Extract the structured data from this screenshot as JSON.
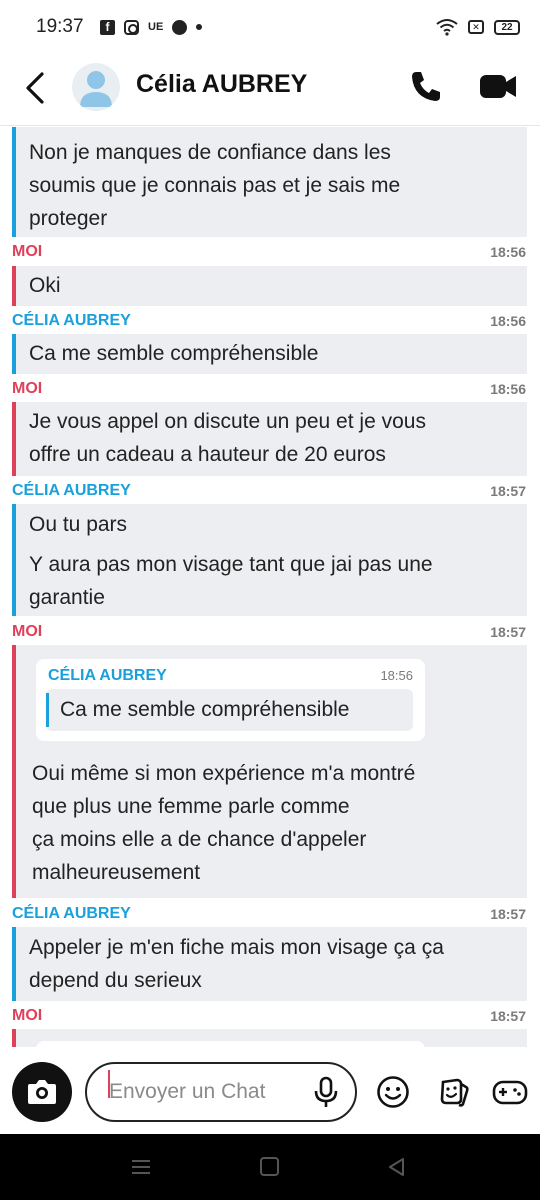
{
  "status_bar": {
    "time": "19:37",
    "app_icons": [
      "facebook-icon",
      "instagram-icon",
      "ue-icon",
      "messenger-icon",
      "dot-icon"
    ],
    "ue_label": "UE",
    "battery": "22"
  },
  "header": {
    "contact_name": "Célia AUBREY"
  },
  "colors": {
    "moi": "#e0415a",
    "celia": "#1aa0db",
    "bubble_bg": "#eceef1"
  },
  "messages": [
    {
      "lines": [
        "Non je manques de confiance dans les",
        "soumis que je connais pas et je sais me",
        "proteger"
      ]
    },
    {
      "sender": "MOI",
      "time": "18:56",
      "lines": [
        "Oki"
      ]
    },
    {
      "sender": "CÉLIA AUBREY",
      "time": "18:56",
      "lines": [
        "Ca me semble compréhensible"
      ]
    },
    {
      "sender": "MOI",
      "time": "18:56",
      "lines": [
        "Je vous appel on discute un peu et je vous",
        "offre un cadeau a hauteur de 20 euros"
      ]
    },
    {
      "sender": "CÉLIA AUBREY",
      "time": "18:57",
      "lines": [
        "Ou tu pars",
        "Y aura pas mon visage tant que jai pas une",
        "garantie"
      ]
    },
    {
      "sender": "MOI",
      "time": "18:57",
      "quote": {
        "sender": "CÉLIA AUBREY",
        "time": "18:56",
        "text": "Ca me semble compréhensible"
      },
      "lines": [
        "Oui même si mon expérience m'a montré",
        "que plus une femme parle comme",
        "ça moins elle a de chance d'appeler",
        "malheureusement"
      ]
    },
    {
      "sender": "CÉLIA AUBREY",
      "time": "18:57",
      "lines": [
        "Appeler je m'en fiche mais mon visage ça ça",
        "depend du serieux"
      ]
    },
    {
      "sender": "MOI",
      "time": "18:57",
      "lines": []
    }
  ],
  "input": {
    "placeholder": "Envoyer un Chat"
  }
}
